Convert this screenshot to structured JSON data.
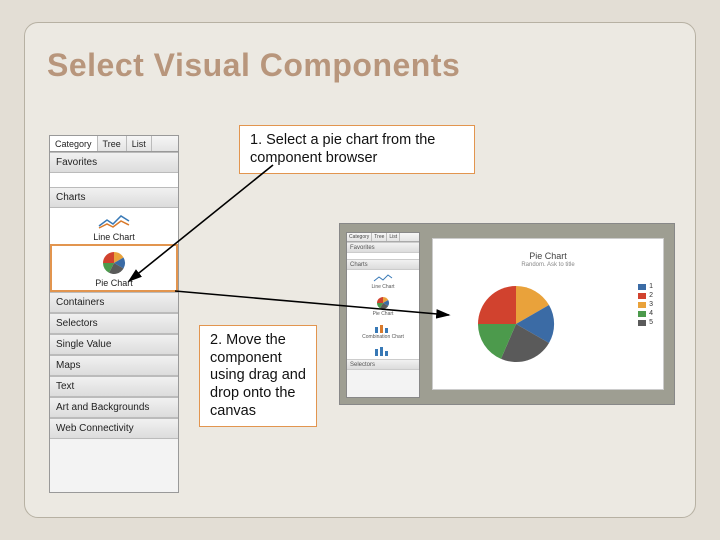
{
  "title": "Select Visual Components",
  "callouts": {
    "step1": "1. Select a pie chart from the component browser",
    "step2": "2. Move the component using drag and drop onto the canvas"
  },
  "browser": {
    "tabs": [
      "Category",
      "Tree",
      "List"
    ],
    "favorites": "Favorites",
    "sections": {
      "charts": "Charts",
      "containers": "Containers",
      "selectors": "Selectors",
      "single_value": "Single Value",
      "maps": "Maps",
      "text": "Text",
      "art": "Art and Backgrounds",
      "web": "Web Connectivity"
    },
    "items": {
      "line": "Line Chart",
      "pie": "Pie Chart"
    }
  },
  "screenshot": {
    "tabs": [
      "Category",
      "Tree",
      "List"
    ],
    "favorites": "Favorites",
    "charts": "Charts",
    "line": "Line Chart",
    "pie": "Pie Chart",
    "combo": "Combination Chart",
    "selectors": "Selectors",
    "canvas_title": "Pie Chart",
    "canvas_sub": "Random. Ask to title",
    "legend": [
      "1",
      "2",
      "3",
      "4",
      "5"
    ]
  },
  "colors": {
    "pie": [
      "#3B6BA5",
      "#D1422E",
      "#E9A23B",
      "#4C9A4C",
      "#5A5A5A"
    ]
  }
}
